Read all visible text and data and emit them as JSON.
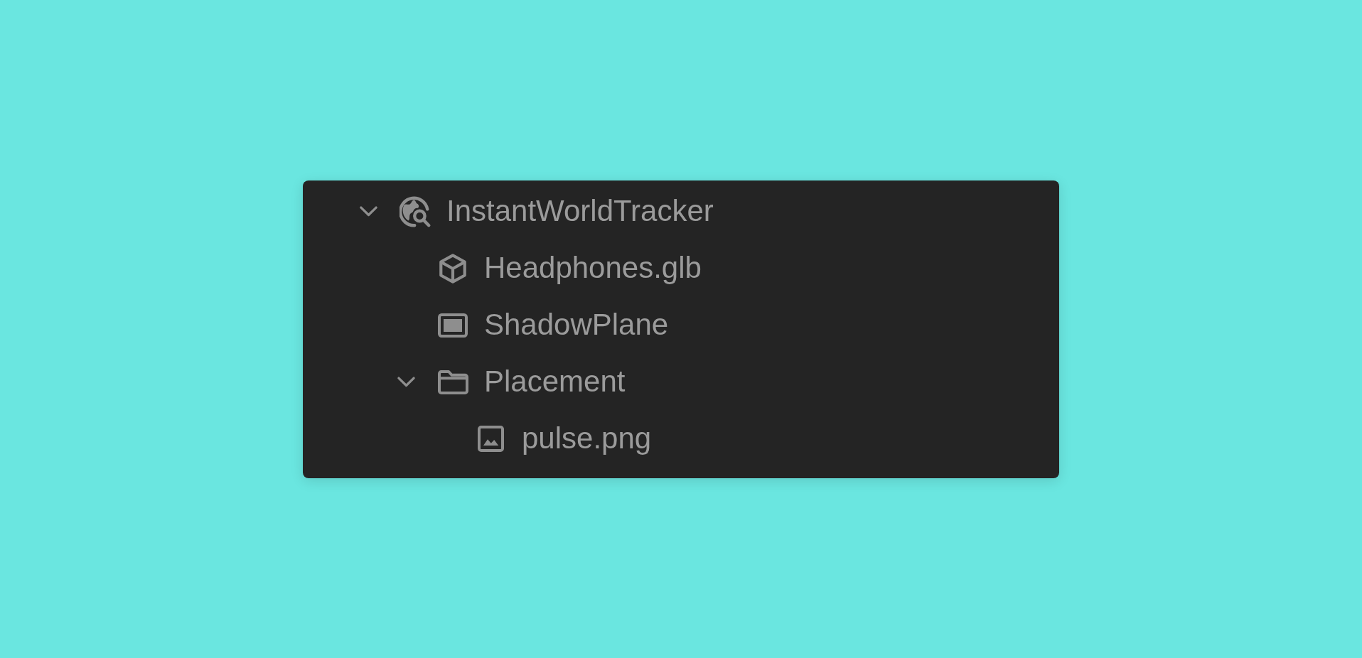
{
  "tree": [
    {
      "label": "InstantWorldTracker",
      "kind": "world-tracker",
      "expanded": true,
      "children": [
        {
          "label": "Headphones.glb",
          "kind": "model"
        },
        {
          "label": "ShadowPlane",
          "kind": "plane"
        },
        {
          "label": "Placement",
          "kind": "folder",
          "expanded": true,
          "children": [
            {
              "label": "pulse.png",
              "kind": "image"
            }
          ]
        }
      ]
    }
  ]
}
